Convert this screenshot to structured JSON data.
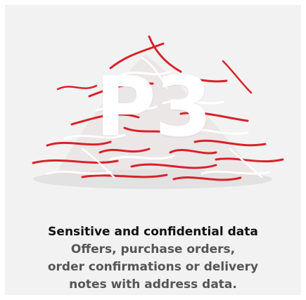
{
  "card": {
    "level_code": "P3",
    "headline": "Sensitive and confidential data",
    "description_lines": [
      "Offers, purchase orders,",
      "order confirmations or delivery",
      "notes with address data."
    ]
  },
  "image": {
    "subject": "pile of red and white shredded paper strips",
    "colors": {
      "red": "#d9212a",
      "white": "#ffffff",
      "background": "#f2f2f2"
    }
  }
}
